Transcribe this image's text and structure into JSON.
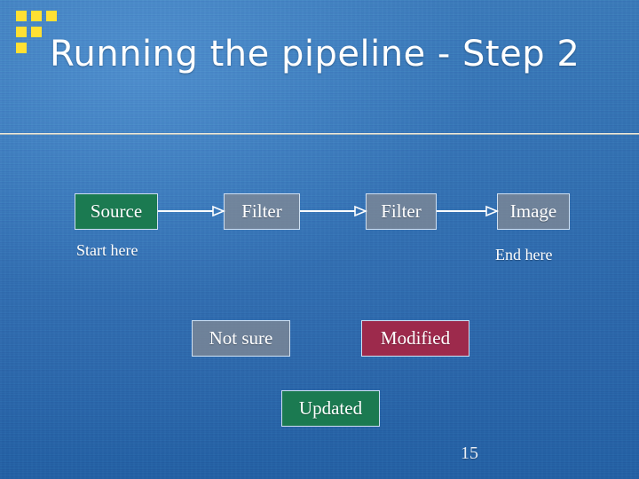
{
  "slide": {
    "title": "Running the pipeline - Step 2",
    "slide_number": "15",
    "background_color": "#2e6cb0",
    "divider_color": "#f2efe0"
  },
  "decoration": {
    "name": "yellow-squares-motif",
    "color": "#ffe033",
    "squares": 6
  },
  "diagram": {
    "pipeline": [
      {
        "label": "Source",
        "fill": "#1b7a51",
        "style": "green"
      },
      {
        "label": "Filter",
        "fill": "#808894",
        "style": "gray"
      },
      {
        "label": "Filter",
        "fill": "#808894",
        "style": "gray"
      },
      {
        "label": "Image",
        "fill": "#808894",
        "style": "gray"
      }
    ],
    "arrows": [
      {
        "from": "Source",
        "to": "Filter"
      },
      {
        "from": "Filter",
        "to": "Filter"
      },
      {
        "from": "Filter",
        "to": "Image"
      }
    ],
    "captions": {
      "start": "Start here",
      "end": "End here"
    },
    "legend": [
      {
        "label": "Not sure",
        "fill": "#808894",
        "style": "gray"
      },
      {
        "label": "Modified",
        "fill": "#9d2a4c",
        "style": "red"
      },
      {
        "label": "Updated",
        "fill": "#1b7a51",
        "style": "green"
      }
    ]
  }
}
